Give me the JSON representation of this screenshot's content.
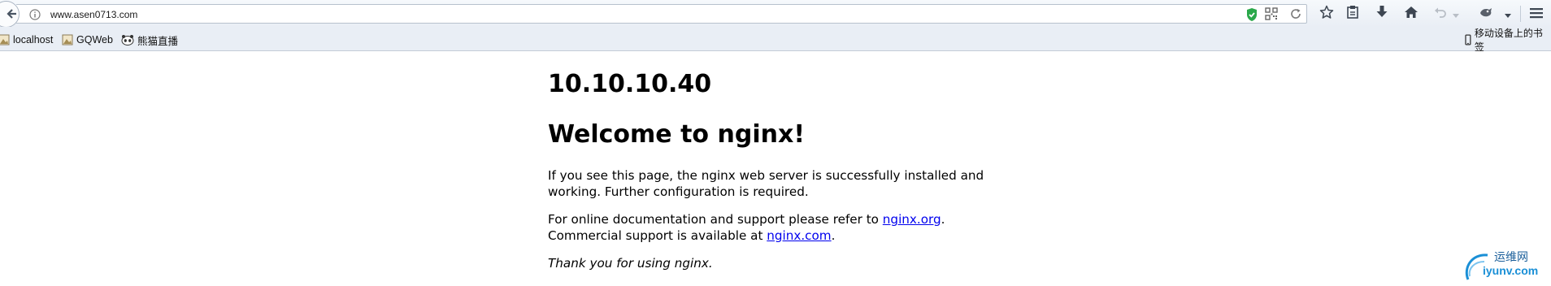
{
  "browser": {
    "url": "www.asen0713.com",
    "icons": {
      "back": "back-arrow-icon",
      "info": "info-icon",
      "shield": "shield-check-icon",
      "qr": "qr-code-icon",
      "reload": "reload-icon",
      "bookmark_star": "star-icon",
      "library": "clipboard-icon",
      "downloads": "download-arrow-icon",
      "home": "home-icon",
      "undo": "undo-icon",
      "extension": "extension-icon",
      "menu": "hamburger-menu-icon"
    }
  },
  "bookmarks": {
    "items": [
      {
        "label": "localhost",
        "icon": "image-bookmark-icon"
      },
      {
        "label": "GQWeb",
        "icon": "image-bookmark-icon"
      },
      {
        "label": "熊猫直播",
        "icon": "panda-icon"
      }
    ],
    "mobile_label": "移动设备上的书签"
  },
  "page": {
    "ip": "10.10.10.40",
    "title": "Welcome to nginx!",
    "para1_line1": "If you see this page, the nginx web server is successfully installed and",
    "para1_line2": "working. Further configuration is required.",
    "para2_line1_pre": "For online documentation and support please refer to ",
    "para2_link1": "nginx.org",
    "para2_line1_post": ".",
    "para2_line2_pre": "Commercial support is available at ",
    "para2_link2": "nginx.com",
    "para2_line2_post": ".",
    "para3": "Thank you for using nginx."
  },
  "watermark": {
    "cn": "运维网",
    "site": "iyunv.com"
  },
  "colors": {
    "link": "#0000ee",
    "shield": "#2aa84a",
    "watermark": "#1a8fd6"
  }
}
